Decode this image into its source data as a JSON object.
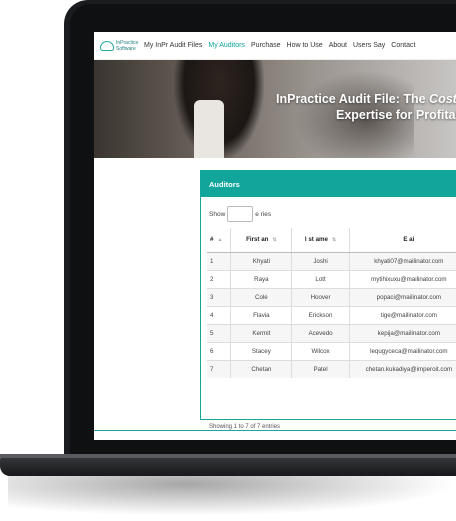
{
  "nav": {
    "logo_line1": "InPractice",
    "logo_line2": "Software",
    "links": [
      "My InPr Audit Files",
      "My Auditors",
      "Purchase",
      "How to Use",
      "About",
      "Users Say",
      "Contact"
    ],
    "active_index": 1
  },
  "hero": {
    "title_prefix": "InPractice Audit File: The ",
    "title_emph": "Cost-Eff",
    "subtitle": "Expertise for Profitabi"
  },
  "card": {
    "title": "Auditors",
    "show_prefix": "Show",
    "show_suffix": "e  ries",
    "columns": [
      "#",
      "First   an",
      "l  st  ame",
      "E  ai"
    ],
    "rows": [
      [
        "1",
        "Khyati",
        "Joshi",
        "khyati07@mailinator.com"
      ],
      [
        "2",
        "Raya",
        "Lott",
        "mytihixuxu@mailinator.com"
      ],
      [
        "3",
        "Cole",
        "Hoover",
        "popaci@mailinator.com"
      ],
      [
        "4",
        "Flavia",
        "Erickson",
        "tige@mailinator.com"
      ],
      [
        "5",
        "Kermit",
        "Acevedo",
        "kepija@mailinator.com"
      ],
      [
        "6",
        "Stacey",
        "Wilcox",
        "lequgyceca@mailinator.com"
      ],
      [
        "7",
        "Chetan",
        "Patel",
        "chetan.kukadiya@imperoit.com"
      ]
    ],
    "info": "Showing 1 to 7 of 7 entries"
  },
  "colors": {
    "accent": "#11a59c",
    "active_link": "#0ea39a"
  }
}
